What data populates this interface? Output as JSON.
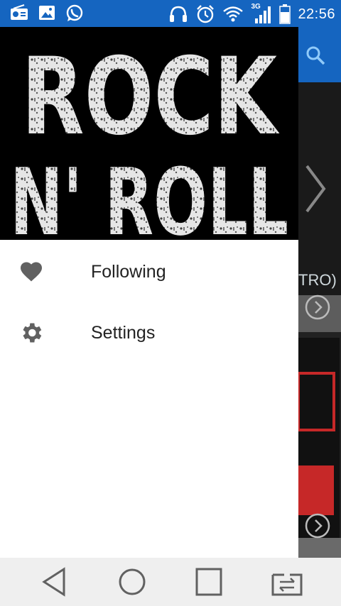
{
  "status_bar": {
    "time": "22:56",
    "network": "3G",
    "left_icons": [
      "radio-icon",
      "image-icon",
      "whatsapp-icon"
    ],
    "right_icons": [
      "headset-icon",
      "alarm-icon",
      "wifi-icon",
      "signal-icon",
      "battery-icon"
    ]
  },
  "header_art": {
    "line1": "ROCK",
    "line2": "N' ROLL"
  },
  "drawer": {
    "items": [
      {
        "label": "Following",
        "icon": "heart-icon"
      },
      {
        "label": "Settings",
        "icon": "gear-icon"
      }
    ]
  },
  "background": {
    "search_icon": "search-icon",
    "partial_text": "TRO)"
  },
  "navbar": {
    "buttons": [
      "back-icon",
      "home-icon",
      "recents-icon",
      "screen-switch-icon"
    ]
  },
  "colors": {
    "accent": "#1565c0",
    "drawer_bg": "#ffffff",
    "icon_grey": "#616161"
  }
}
